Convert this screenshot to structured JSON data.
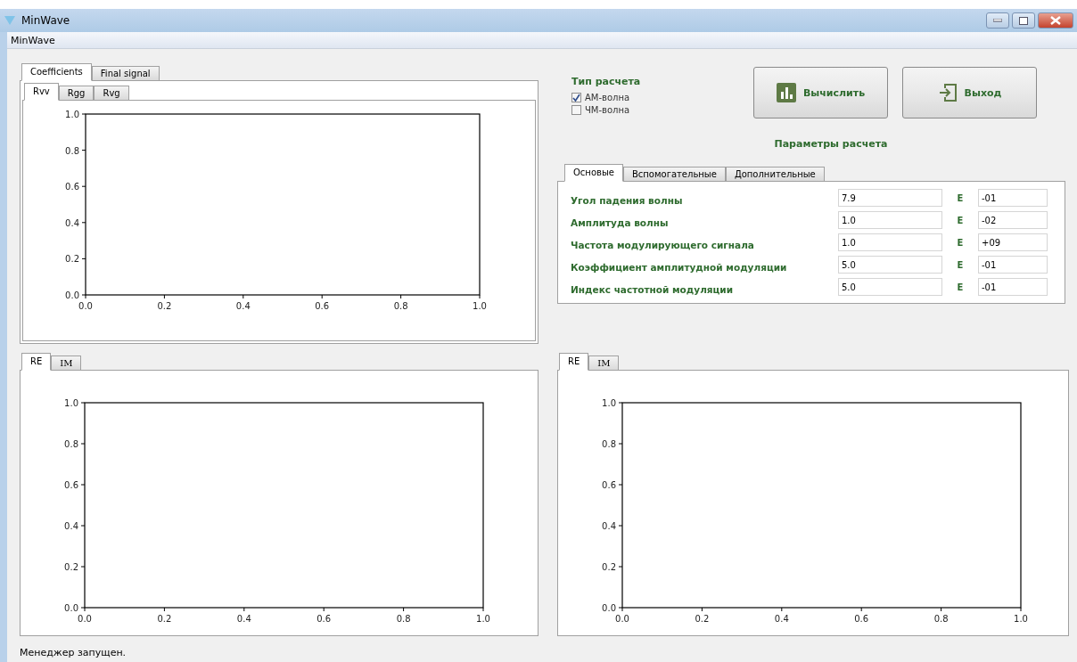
{
  "window": {
    "title": "MinWave"
  },
  "menu_bar": {
    "items": [
      "MinWave"
    ]
  },
  "main_tabs": [
    {
      "label": "Coefficients",
      "selected": true
    },
    {
      "label": "Final signal",
      "selected": false
    }
  ],
  "coefficient_tabs": [
    {
      "label": "Rvv",
      "selected": true
    },
    {
      "label": "Rgg",
      "selected": false
    },
    {
      "label": "Rvg",
      "selected": false
    }
  ],
  "coefficient_chart": {
    "chart_data": {
      "type": "line",
      "xlim": [
        0,
        1
      ],
      "ylim": [
        0,
        1
      ],
      "xticks": [
        {
          "value": 0,
          "label": "0.0"
        },
        {
          "value": 0.2,
          "label": "0.2"
        },
        {
          "value": 0.4,
          "label": "0.4"
        },
        {
          "value": 0.6,
          "label": "0.6"
        },
        {
          "value": 0.8,
          "label": "0.8"
        },
        {
          "value": 1,
          "label": "1.0"
        }
      ],
      "yticks": [
        {
          "value": 0,
          "label": "0.0"
        },
        {
          "value": 0.2,
          "label": "0.2"
        },
        {
          "value": 0.4,
          "label": "0.4"
        },
        {
          "value": 0.6,
          "label": "0.6"
        },
        {
          "value": 0.8,
          "label": "0.8"
        },
        {
          "value": 1,
          "label": "1.0"
        }
      ]
    }
  },
  "calculation_type": {
    "title": "Тип расчета",
    "options": [
      {
        "label": "АМ-волна",
        "checked": true
      },
      {
        "label": "ЧМ-волна",
        "checked": false
      }
    ]
  },
  "buttons": [
    {
      "label": "Вычислить",
      "kind": "compute"
    },
    {
      "label": "Выход",
      "kind": "exit"
    }
  ],
  "parameters": {
    "title": "Параметры расчета",
    "tabs": [
      {
        "label": "Основые",
        "selected": true
      },
      {
        "label": "Вспомогательные",
        "selected": false
      },
      {
        "label": "Дополнительные",
        "selected": false
      }
    ],
    "rows": [
      {
        "label": "Угол падения волны",
        "mantissa": "7.9",
        "separator": "E",
        "exponent": "-01"
      },
      {
        "label": "Амплитуда волны",
        "mantissa": "1.0",
        "separator": "E",
        "exponent": "-02"
      },
      {
        "label": "Частота модулирующего сигнала",
        "mantissa": "1.0",
        "separator": "E",
        "exponent": "+09"
      },
      {
        "label": "Коэффициент амплитудной модуляции",
        "mantissa": "5.0",
        "separator": "E",
        "exponent": "-01"
      },
      {
        "label": "Индекс частотной модуляции",
        "mantissa": "5.0",
        "separator": "E",
        "exponent": "-01"
      }
    ]
  },
  "lower_left": {
    "tabs": [
      {
        "label": "RE",
        "selected": true
      },
      {
        "label": "IM",
        "selected": false
      }
    ],
    "chart_data": {
      "type": "line",
      "xlim": [
        0,
        1
      ],
      "ylim": [
        0,
        1
      ],
      "xticks": [
        {
          "value": 0,
          "label": "0.0"
        },
        {
          "value": 0.2,
          "label": "0.2"
        },
        {
          "value": 0.4,
          "label": "0.4"
        },
        {
          "value": 0.6,
          "label": "0.6"
        },
        {
          "value": 0.8,
          "label": "0.8"
        },
        {
          "value": 1,
          "label": "1.0"
        }
      ],
      "yticks": [
        {
          "value": 0,
          "label": "0.0"
        },
        {
          "value": 0.2,
          "label": "0.2"
        },
        {
          "value": 0.4,
          "label": "0.4"
        },
        {
          "value": 0.6,
          "label": "0.6"
        },
        {
          "value": 0.8,
          "label": "0.8"
        },
        {
          "value": 1,
          "label": "1.0"
        }
      ]
    }
  },
  "lower_right": {
    "tabs": [
      {
        "label": "RE",
        "selected": true
      },
      {
        "label": "IM",
        "selected": false
      }
    ],
    "chart_data": {
      "type": "line",
      "xlim": [
        0,
        1
      ],
      "ylim": [
        0,
        1
      ],
      "xticks": [
        {
          "value": 0,
          "label": "0.0"
        },
        {
          "value": 0.2,
          "label": "0.2"
        },
        {
          "value": 0.4,
          "label": "0.4"
        },
        {
          "value": 0.6,
          "label": "0.6"
        },
        {
          "value": 0.8,
          "label": "0.8"
        },
        {
          "value": 1,
          "label": "1.0"
        }
      ],
      "yticks": [
        {
          "value": 0,
          "label": "0.0"
        },
        {
          "value": 0.2,
          "label": "0.2"
        },
        {
          "value": 0.4,
          "label": "0.4"
        },
        {
          "value": 0.6,
          "label": "0.6"
        },
        {
          "value": 0.8,
          "label": "0.8"
        },
        {
          "value": 1,
          "label": "1.0"
        }
      ]
    }
  },
  "status_bar": {
    "text": "Менеджер запущен."
  }
}
